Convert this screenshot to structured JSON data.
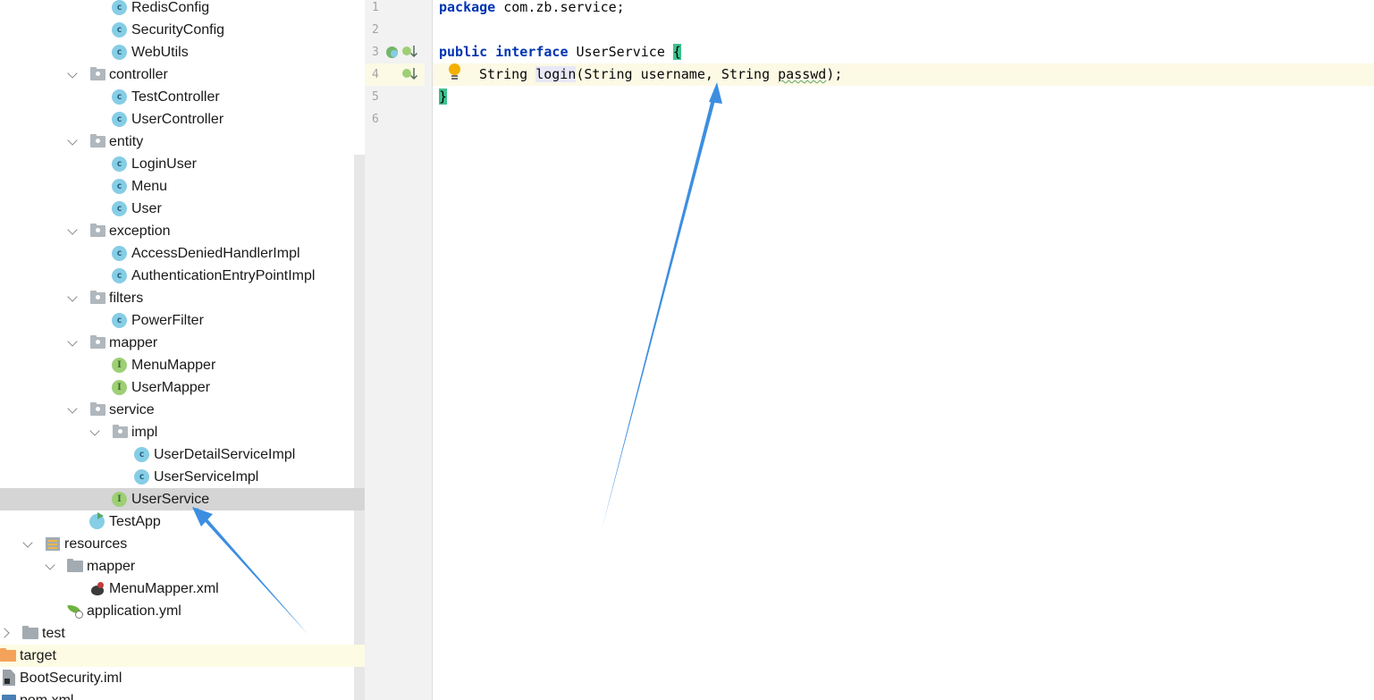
{
  "project_tree": {
    "items": [
      {
        "label": "RedisConfig",
        "icon": "class-icon"
      },
      {
        "label": "SecurityConfig",
        "icon": "class-icon"
      },
      {
        "label": "WebUtils",
        "icon": "class-icon"
      },
      {
        "label": "controller",
        "icon": "package-icon",
        "expanded": true
      },
      {
        "label": "TestController",
        "icon": "class-icon"
      },
      {
        "label": "UserController",
        "icon": "class-icon"
      },
      {
        "label": "entity",
        "icon": "package-icon",
        "expanded": true
      },
      {
        "label": "LoginUser",
        "icon": "class-icon"
      },
      {
        "label": "Menu",
        "icon": "class-icon"
      },
      {
        "label": "User",
        "icon": "class-icon"
      },
      {
        "label": "exception",
        "icon": "package-icon",
        "expanded": true
      },
      {
        "label": "AccessDeniedHandlerImpl",
        "icon": "class-icon"
      },
      {
        "label": "AuthenticationEntryPointImpl",
        "icon": "class-icon"
      },
      {
        "label": "filters",
        "icon": "package-icon",
        "expanded": true
      },
      {
        "label": "PowerFilter",
        "icon": "class-icon"
      },
      {
        "label": "mapper",
        "icon": "package-icon",
        "expanded": true
      },
      {
        "label": "MenuMapper",
        "icon": "interface-icon"
      },
      {
        "label": "UserMapper",
        "icon": "interface-icon"
      },
      {
        "label": "service",
        "icon": "package-icon",
        "expanded": true
      },
      {
        "label": "impl",
        "icon": "package-icon",
        "expanded": true
      },
      {
        "label": "UserDetailServiceImpl",
        "icon": "class-icon"
      },
      {
        "label": "UserServiceImpl",
        "icon": "class-icon"
      },
      {
        "label": "UserService",
        "icon": "interface-icon",
        "selected": true
      },
      {
        "label": "TestApp",
        "icon": "app-class-icon"
      },
      {
        "label": "resources",
        "icon": "resources-folder-icon",
        "expanded": true
      },
      {
        "label": "mapper",
        "icon": "folder-icon",
        "expanded": true
      },
      {
        "label": "MenuMapper.xml",
        "icon": "mybatis-xml-icon"
      },
      {
        "label": "application.yml",
        "icon": "spring-yml-icon"
      },
      {
        "label": "test",
        "icon": "folder-icon",
        "expanded": false
      },
      {
        "label": "target",
        "icon": "excluded-folder-icon"
      },
      {
        "label": "BootSecurity.iml",
        "icon": "iml-file-icon"
      },
      {
        "label": "pom.xml",
        "icon": "maven-icon"
      }
    ]
  },
  "editor": {
    "line_numbers": [
      "1",
      "2",
      "3",
      "4",
      "5",
      "6"
    ],
    "code": {
      "l1_kw": "package",
      "l1_rest": " com.zb.service;",
      "l3_kw1": "public",
      "l3_kw2": "interface",
      "l3_name": " UserService ",
      "l3_brace": "{",
      "l4_type": "String ",
      "l4_method": "login",
      "l4_params_a": "(String username, String ",
      "l4_param_b": "passwd",
      "l4_end": ");",
      "l5_brace": "}"
    }
  },
  "colors": {
    "keyword": "#0033b3",
    "brace_match": "#3ec28f",
    "selection": "#d5d5d5",
    "annotation_arrow": "#3d8ee0"
  }
}
